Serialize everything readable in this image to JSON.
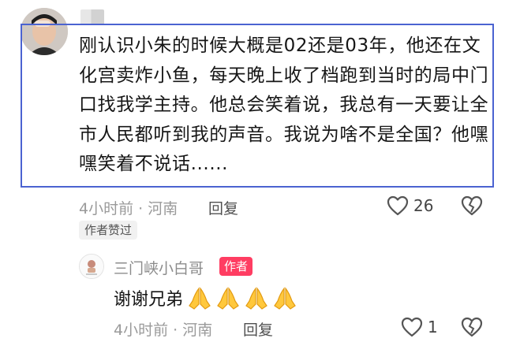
{
  "comment": {
    "text": "刚认识小朱的时候大概是02还是03年，他还在文化宫卖炸小鱼，每天晚上收了档跑到当时的局中门口找我学主持。他总会笑着说，我总有一天要让全市人民都听到我的声音。我说为啥不是全国？他嘿嘿笑着不说话......",
    "time_location": "4小时前 · 河南",
    "reply_label": "回复",
    "likes": "26",
    "author_liked_badge": "作者赞过"
  },
  "reply": {
    "username": "三门峡小白哥",
    "author_tag": "作者",
    "text": "谢谢兄弟",
    "emojis": [
      "folded-hands-icon",
      "folded-hands-icon",
      "folded-hands-icon",
      "folded-hands-icon"
    ],
    "time_location": "4小时前 · 河南",
    "reply_label": "回复",
    "likes": "1"
  },
  "colors": {
    "highlight_border": "#4b63d1",
    "author_tag_bg": "#ff3d62",
    "meta_gray": "#9a9a9a"
  }
}
